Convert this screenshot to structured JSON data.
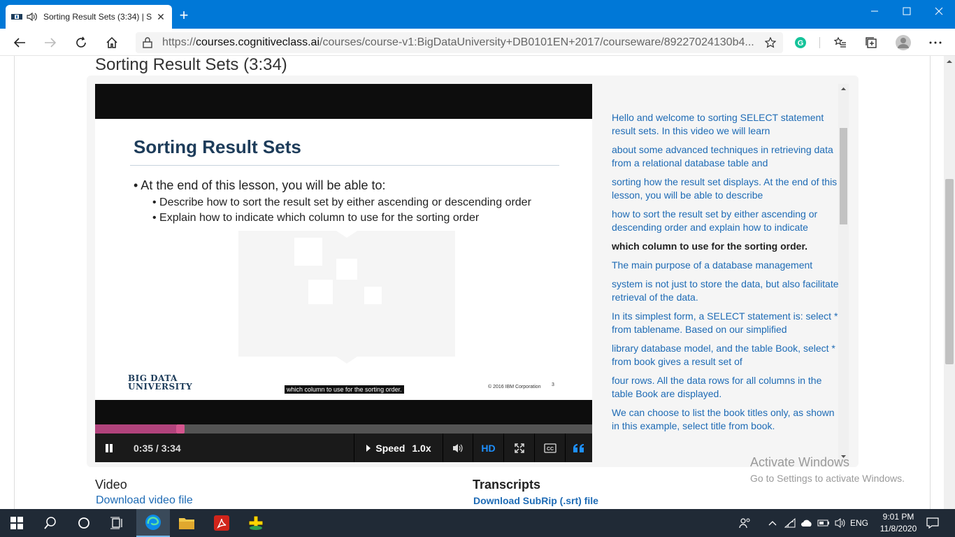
{
  "browser": {
    "tab_title": "Sorting Result Sets (3:34) | S",
    "url_scheme": "https://",
    "url_host": "courses.cognitiveclass.ai",
    "url_path": "/courses/course-v1:BigDataUniversity+DB0101EN+2017/courseware/89227024130b4...",
    "new_tab_label": "+"
  },
  "page": {
    "title": "Sorting Result Sets (3:34)"
  },
  "slide": {
    "heading": "Sorting Result Sets",
    "bullet": "• At the end of this lesson, you will be able to:",
    "sub1": "• Describe how to sort the result set by either ascending or descending order",
    "sub2": "• Explain how to indicate which column to use for the sorting order",
    "logo_line1": "BIG DATA",
    "logo_line2": "UNIVERSITY",
    "caption": "which column to use for the sorting order.",
    "copyright": "© 2016 IBM Corporation",
    "page_number": "3"
  },
  "player": {
    "time": "0:35 / 3:34",
    "progress_fraction": 0.1636,
    "speed_label": "Speed",
    "speed_value": "1.0x",
    "hd_label": "HD"
  },
  "transcript": {
    "lines": [
      "Hello and welcome to sorting SELECT statement result sets. In this video we will learn",
      "about some advanced techniques in retrieving data from a relational database table and",
      "sorting how the result set displays. At the end of this lesson, you will be able to describe",
      "how to sort the result set by either ascending or descending order and explain how to indicate",
      "which column to use for the sorting order.",
      "The main purpose of a database management",
      "system is not just to store the data, but also facilitate retrieval of the data.",
      "In its simplest form, a SELECT statement is: select * from tablename. Based on our simplified",
      "library database model, and the table Book, select * from book gives a result set of",
      "four rows. All the data rows for all columns in the table Book are displayed.",
      "We can choose to list the book titles only, as shown in this example, select title from book."
    ],
    "active_index": 4
  },
  "downloads": {
    "video_heading": "Video",
    "video_link": "Download video file",
    "transcripts_heading": "Transcripts",
    "transcripts_link": "Download SubRip (.srt) file"
  },
  "watermark": {
    "line1": "Activate Windows",
    "line2": "Go to Settings to activate Windows."
  },
  "taskbar": {
    "language": "ENG",
    "time": "9:01 PM",
    "date": "11/8/2020"
  },
  "colors": {
    "edge_blue": "#0078d7",
    "link_blue": "#1e6bb5",
    "progress_pink": "#b1437c",
    "slide_heading": "#1d3c5a"
  }
}
